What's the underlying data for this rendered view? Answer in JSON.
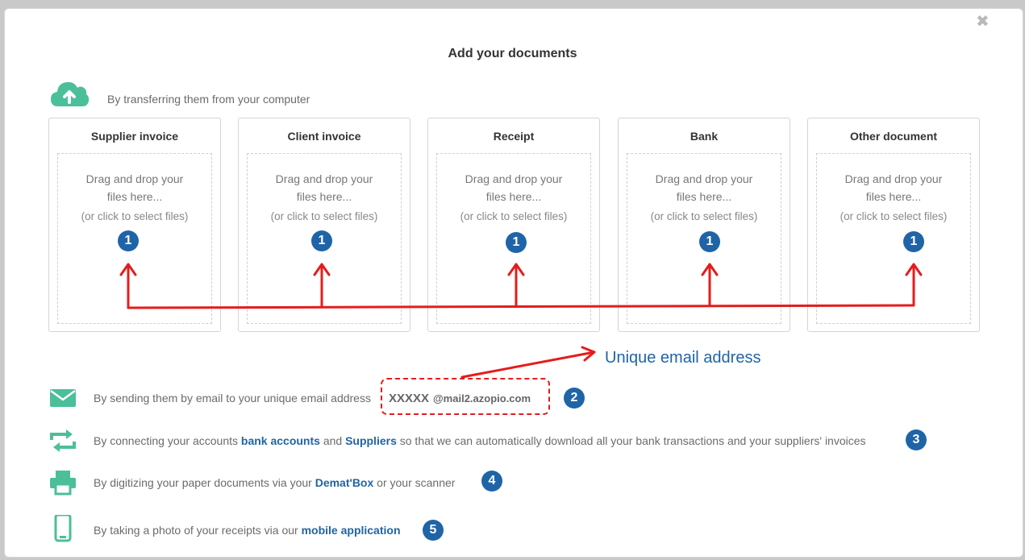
{
  "dialog": {
    "title": "Add your documents",
    "close_icon": "close-icon",
    "close_glyph": "✖"
  },
  "upload": {
    "icon": "cloud-upload-icon",
    "text": "By transferring them from your computer"
  },
  "doc_types": [
    {
      "title": "Supplier invoice",
      "drop_text": "Drag and drop your files here...",
      "select_text": "(or click to select files)",
      "badge": "1"
    },
    {
      "title": "Client invoice",
      "drop_text": "Drag and drop your files here...",
      "select_text": "(or click to select files)",
      "badge": "1"
    },
    {
      "title": "Receipt",
      "drop_text": "Drag and drop your files here...",
      "select_text": "(or click to select files)",
      "badge": "1"
    },
    {
      "title": "Bank",
      "drop_text": "Drag and drop your files here...",
      "select_text": "(or click to select files)",
      "badge": "1"
    },
    {
      "title": "Other document",
      "drop_text": "Drag and drop your files here...",
      "select_text": "(or click to select files)",
      "badge": "1"
    }
  ],
  "annotation": {
    "label": "Unique email address",
    "color": "#e51c1c",
    "badge_color": "#1f64a7"
  },
  "methods": {
    "email": {
      "icon": "envelope-icon",
      "text": "By sending them by email to your unique email address",
      "address_prefix": "XXXXX",
      "address_domain": "@mail2.azopio.com",
      "badge": "2"
    },
    "connect": {
      "icon": "sync-arrows-icon",
      "text_before": "By connecting your accounts",
      "link_bank": "bank accounts",
      "text_and": "and",
      "link_suppliers": "Suppliers",
      "text_after": "so that we can automatically download all your bank transactions and your suppliers' invoices",
      "badge": "3"
    },
    "scan": {
      "icon": "printer-icon",
      "text_before": "By digitizing your paper documents via your",
      "link": "Demat'Box",
      "text_after": "or your scanner",
      "badge": "4"
    },
    "mobile": {
      "icon": "smartphone-icon",
      "text_before": "By taking a photo of your receipts via our",
      "link": "mobile application",
      "badge": "5"
    }
  },
  "colors": {
    "accent_green": "#4bbf9a",
    "link_blue": "#1f64a7"
  }
}
